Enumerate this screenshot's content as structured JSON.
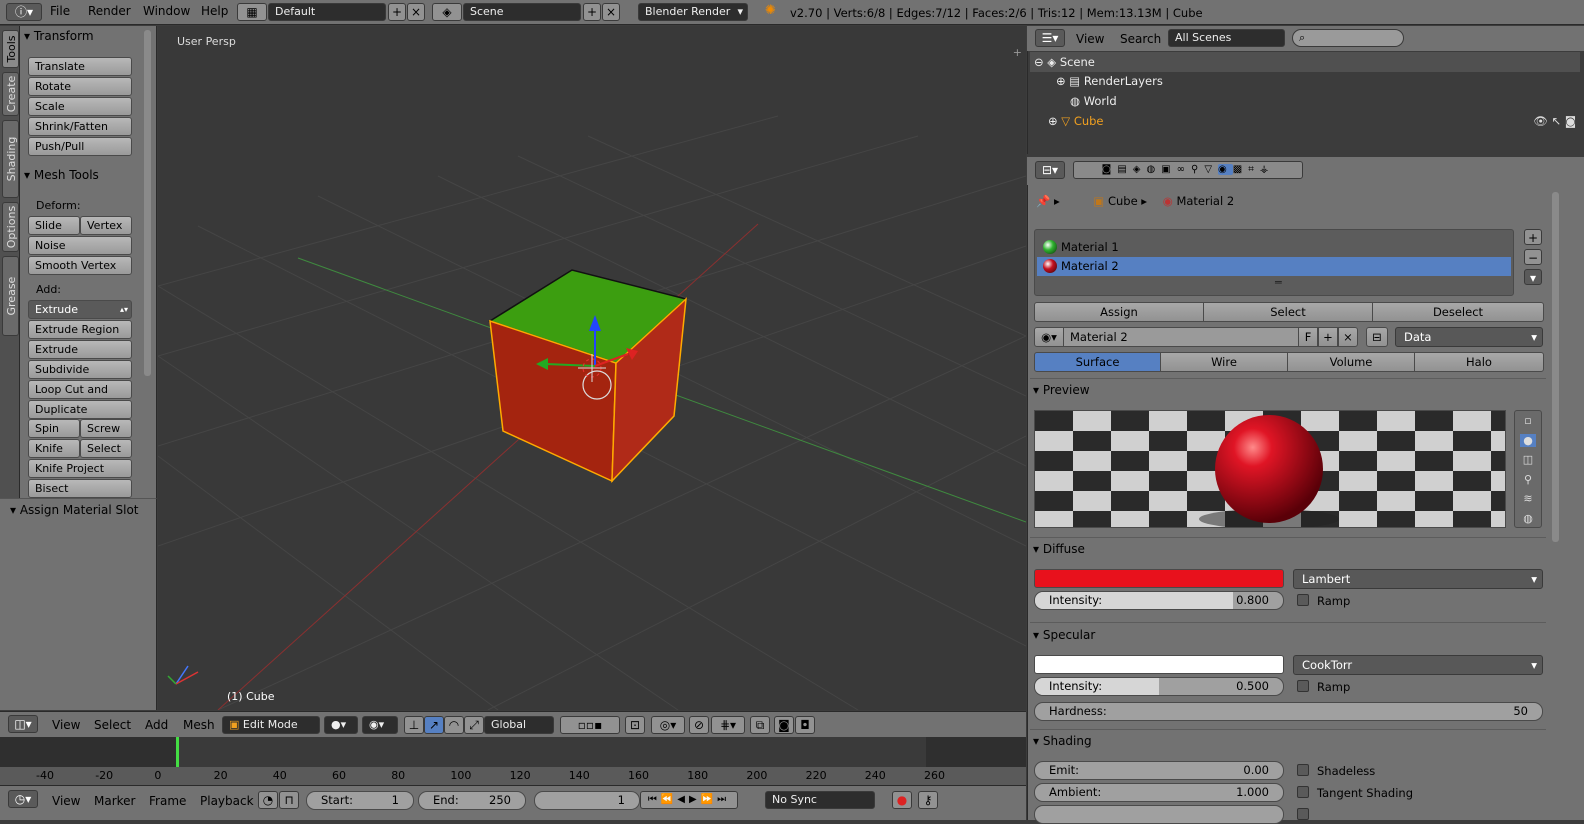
{
  "topbar": {
    "info_icon": "info-icon",
    "menus": [
      "File",
      "Render",
      "Window",
      "Help"
    ],
    "screen_layout": "Default",
    "scene": "Scene",
    "render_engine": "Blender Render",
    "stats": "v2.70 | Verts:6/8 | Edges:7/12 | Faces:2/6 | Tris:12 | Mem:13.13M | Cube"
  },
  "left_tabs": [
    "Tools",
    "Create",
    "Shading / UVs",
    "Options",
    "Grease Pencil"
  ],
  "toolshelf": {
    "transform_title": "Transform",
    "transform_buttons": [
      "Translate",
      "Rotate",
      "Scale",
      "Shrink/Fatten",
      "Push/Pull"
    ],
    "mesh_tools_title": "Mesh Tools",
    "deform_label": "Deform:",
    "slide_edge": "Slide Ed",
    "vertex": "Vertex",
    "noise": "Noise",
    "smooth_vertex": "Smooth Vertex",
    "add_label": "Add:",
    "extrude": "Extrude",
    "extrude_region": "Extrude Region",
    "extrude_individual": "Extrude Individual",
    "subdivide": "Subdivide",
    "loop_cut": "Loop Cut and Slide",
    "duplicate": "Duplicate",
    "spin": "Spin",
    "screw": "Screw",
    "knife": "Knife",
    "select": "Select",
    "knife_project": "Knife Project",
    "bisect": "Bisect",
    "assign_material_slot": "Assign Material Slot"
  },
  "viewport": {
    "view_label": "User Persp",
    "object_label": "(1) Cube",
    "face_colors": {
      "top": "#3c9e10",
      "front": "#a4240f",
      "side": "#b02a18",
      "edge": "#ffaa00"
    }
  },
  "view3d_header": {
    "menus": [
      "View",
      "Select",
      "Add",
      "Mesh"
    ],
    "mode": "Edit Mode",
    "orientation": "Global"
  },
  "timeline": {
    "ticks": [
      "-40",
      "-20",
      "0",
      "20",
      "40",
      "60",
      "80",
      "100",
      "120",
      "140",
      "160",
      "180",
      "200",
      "220",
      "240",
      "260"
    ],
    "current_frame_marker": 0
  },
  "timeline_header": {
    "menus": [
      "View",
      "Marker",
      "Frame",
      "Playback"
    ],
    "start_label": "Start:",
    "start_value": "1",
    "end_label": "End:",
    "end_value": "250",
    "current_frame": "1",
    "sync": "No Sync"
  },
  "outliner": {
    "menus": [
      "View",
      "Search"
    ],
    "filter": "All Scenes",
    "rows": [
      "Scene",
      "RenderLayers",
      "World",
      "Cube"
    ]
  },
  "properties": {
    "breadcrumb_object": "Cube",
    "breadcrumb_material": "Material 2",
    "slots": [
      "Material 1",
      "Material 2"
    ],
    "slot_colors": [
      "#2fb42f",
      "#c41020"
    ],
    "assign": "Assign",
    "select": "Select",
    "deselect": "Deselect",
    "material_name": "Material 2",
    "fake_user": "F",
    "link": "Data",
    "tabs": [
      "Surface",
      "Wire",
      "Volume",
      "Halo"
    ],
    "preview_title": "Preview",
    "diffuse_title": "Diffuse",
    "diffuse_color": "#e8111c",
    "diffuse_shader": "Lambert",
    "diffuse_intensity_label": "Intensity:",
    "diffuse_intensity": "0.800",
    "diffuse_intensity_fraction": 0.8,
    "ramp_label": "Ramp",
    "specular_title": "Specular",
    "specular_color": "#ffffff",
    "specular_shader": "CookTorr",
    "specular_intensity_label": "Intensity:",
    "specular_intensity": "0.500",
    "specular_intensity_fraction": 0.5,
    "spec_ramp_label": "Ramp",
    "hardness_label": "Hardness:",
    "hardness": "50",
    "shading_title": "Shading",
    "emit_label": "Emit:",
    "emit": "0.00",
    "ambient_label": "Ambient:",
    "ambient": "1.000",
    "shadeless_label": "Shadeless",
    "tangent_label": "Tangent Shading"
  }
}
